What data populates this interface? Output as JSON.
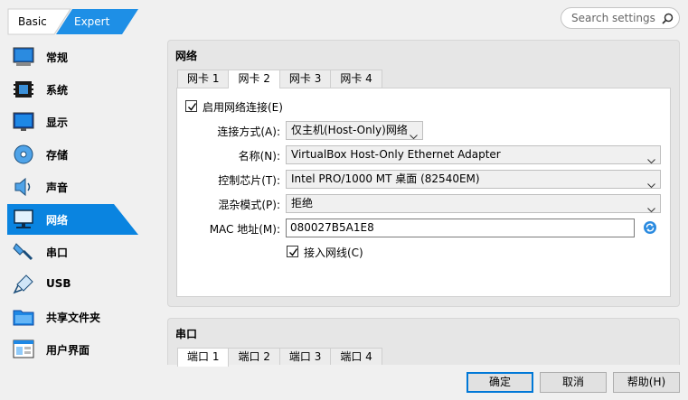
{
  "mode": {
    "basic": "Basic",
    "expert": "Expert"
  },
  "search": {
    "placeholder": "Search settings"
  },
  "sidebar": {
    "items": [
      {
        "label": "常规",
        "icon": "general-icon"
      },
      {
        "label": "系统",
        "icon": "system-icon"
      },
      {
        "label": "显示",
        "icon": "display-icon"
      },
      {
        "label": "存储",
        "icon": "storage-icon"
      },
      {
        "label": "声音",
        "icon": "audio-icon"
      },
      {
        "label": "网络",
        "icon": "network-icon",
        "active": true
      },
      {
        "label": "串口",
        "icon": "serial-port-icon"
      },
      {
        "label": "USB",
        "icon": "usb-icon"
      },
      {
        "label": "共享文件夹",
        "icon": "shared-folder-icon"
      },
      {
        "label": "用户界面",
        "icon": "user-interface-icon"
      }
    ]
  },
  "network": {
    "title": "网络",
    "tabs": [
      "网卡 1",
      "网卡 2",
      "网卡 3",
      "网卡 4"
    ],
    "active_tab": 1,
    "enable_label": "启用网络连接(E)",
    "enable_checked": true,
    "attach_label": "连接方式(A):",
    "attach_value": "仅主机(Host-Only)网络",
    "name_label": "名称(N):",
    "name_value": "VirtualBox Host-Only Ethernet Adapter",
    "adapter_label": "控制芯片(T):",
    "adapter_value": "Intel PRO/1000 MT 桌面 (82540EM)",
    "promisc_label": "混杂模式(P):",
    "promisc_value": "拒绝",
    "mac_label": "MAC 地址(M):",
    "mac_value": "080027B5A1E8",
    "cable_label": "接入网线(C)",
    "cable_checked": true
  },
  "serial": {
    "title": "串口",
    "tabs": [
      "端口 1",
      "端口 2",
      "端口 3",
      "端口 4"
    ],
    "active_tab": 0
  },
  "buttons": {
    "ok": "确定",
    "cancel": "取消",
    "help": "帮助(H)"
  },
  "colors": {
    "accent": "#1e8fe6",
    "selection": "#0a84e0"
  }
}
